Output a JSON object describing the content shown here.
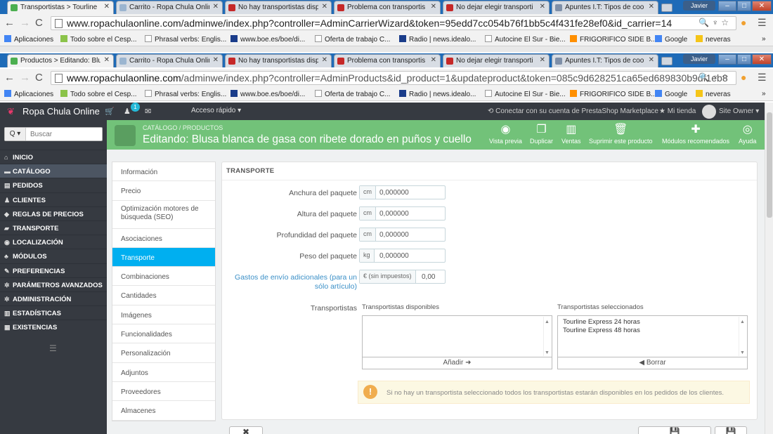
{
  "browser_back": {
    "tabs": [
      {
        "title": "Transportistas > Tourline",
        "fav": "#4caf50"
      },
      {
        "title": "Carrito - Ropa Chula Onlin",
        "fav": "#9bb5d0"
      },
      {
        "title": "No hay transportistas disp",
        "fav": "#c62828"
      },
      {
        "title": "Problema con transportis",
        "fav": "#c62828"
      },
      {
        "title": "No dejar elegir transporti",
        "fav": "#c62828"
      },
      {
        "title": "Apuntes I.T: Tipos de coo",
        "fav": "#7e8fa8"
      }
    ],
    "url": "www.ropachulaonline.com/adminwe/index.php?controller=AdminCarrierWizard&token=95edd7cc054b76f1bb5c4f431fe28ef0&id_carrier=14",
    "url_host": "www.ropachulaonline.com",
    "user": "Javier"
  },
  "browser_front": {
    "tabs": [
      {
        "title": "Productos > Editando: Blu",
        "fav": "#4caf50"
      },
      {
        "title": "Carrito - Ropa Chula Onlin",
        "fav": "#9bb5d0"
      },
      {
        "title": "No hay transportistas disp",
        "fav": "#c62828"
      },
      {
        "title": "Problema con transportis",
        "fav": "#c62828"
      },
      {
        "title": "No dejar elegir transporti",
        "fav": "#c62828"
      },
      {
        "title": "Apuntes I.T: Tipos de coo",
        "fav": "#7e8fa8"
      }
    ],
    "url_host": "www.ropachulaonline.com",
    "url_rest": "/adminwe/index.php?controller=AdminProducts&id_product=1&updateproduct&token=085c9d628251ca65ed689830b9df1eb8",
    "user": "Javier"
  },
  "bookmarks": [
    {
      "label": "Aplicaciones",
      "color": "#4285f4"
    },
    {
      "label": "Todo sobre el Cesp...",
      "color": "#8bc34a"
    },
    {
      "label": "Phrasal verbs: Englis...",
      "color": "#ffffff"
    },
    {
      "label": "www.boe.es/boe/di...",
      "color": "#1a3c8a"
    },
    {
      "label": "Oferta de trabajo C...",
      "color": "#ffffff"
    },
    {
      "label": "Radio | news.idealo...",
      "color": "#1a3c8a"
    },
    {
      "label": "Autocine El Sur - Bie...",
      "color": "#ffffff"
    },
    {
      "label": "FRIGORIFICO SIDE B...",
      "color": "#ff8f00"
    },
    {
      "label": "Google",
      "color": "#4285f4"
    },
    {
      "label": "neveras",
      "color": "#f5c518"
    }
  ],
  "header": {
    "brand": "Ropa Chula Online",
    "cart_badge": "1",
    "quick_access": "Acceso rápido ▾",
    "connect": "Conectar con su cuenta de PrestaShop Marketplace",
    "my_shop": "Mi tienda",
    "owner": "Site Owner ▾"
  },
  "sidebar": {
    "search_button": "Q ▾",
    "search_placeholder": "Buscar",
    "items": [
      {
        "label": "Inicio",
        "icon": "⌂"
      },
      {
        "label": "Catálogo",
        "icon": "▬"
      },
      {
        "label": "Pedidos",
        "icon": "▤"
      },
      {
        "label": "Clientes",
        "icon": "♟"
      },
      {
        "label": "Reglas de precios",
        "icon": "◆"
      },
      {
        "label": "Transporte",
        "icon": "▰"
      },
      {
        "label": "Localización",
        "icon": "◉"
      },
      {
        "label": "Módulos",
        "icon": "♣"
      },
      {
        "label": "Preferencias",
        "icon": "✎"
      },
      {
        "label": "Parámetros avanzados",
        "icon": "✲"
      },
      {
        "label": "Administración",
        "icon": "✲"
      },
      {
        "label": "Estadísticas",
        "icon": "▥"
      },
      {
        "label": "Existencias",
        "icon": "▦"
      }
    ]
  },
  "page": {
    "breadcrumb_1": "CATÁLOGO",
    "breadcrumb_sep": "/",
    "breadcrumb_2": "PRODUCTOS",
    "title": "Editando: Blusa blanca de gasa con ribete dorado en puños y cuello",
    "actions": [
      {
        "label": "Vista previa",
        "icon": "◉"
      },
      {
        "label": "Duplicar",
        "icon": "❐"
      },
      {
        "label": "Ventas",
        "icon": "▥"
      },
      {
        "label": "Suprimir este producto",
        "icon": "🗑"
      },
      {
        "label": "Módulos recomendados",
        "icon": "✚"
      },
      {
        "label": "Ayuda",
        "icon": "◎"
      }
    ]
  },
  "product_tabs": [
    "Información",
    "Precio",
    "Optimización motores de búsqueda (SEO)",
    "Asociaciones",
    "Transporte",
    "Combinaciones",
    "Cantidades",
    "Imágenes",
    "Funcionalidades",
    "Personalización",
    "Adjuntos",
    "Proveedores",
    "Almacenes"
  ],
  "shipping": {
    "section_title": "TRANSPORTE",
    "width_label": "Anchura del paquete",
    "width_unit": "cm",
    "width_value": "0,000000",
    "height_label": "Altura del paquete",
    "height_unit": "cm",
    "height_value": "0,000000",
    "depth_label": "Profundidad del paquete",
    "depth_unit": "cm",
    "depth_value": "0,000000",
    "weight_label": "Peso del paquete",
    "weight_unit": "kg",
    "weight_value": "0,000000",
    "extra_label_1": "Gastos de envío adicionales (para un",
    "extra_label_2": "sólo artículo)",
    "extra_unit": "€ (sin impuestos)",
    "extra_value": "0,00",
    "carriers_label": "Transportistas",
    "available_label": "Transportistas disponibles",
    "selected_label": "Transportistas seleccionados",
    "selected_carriers": [
      "Tourline Express 24 horas",
      "Tourline Express 48 horas"
    ],
    "add_button": "Añadir ➜",
    "remove_button": "◀ Borrar",
    "alert_text": "Si no hay un transportista seleccionado todos los transportistas estarán disponibles en los pedidos de los clientes.",
    "alert_icon": "!"
  }
}
